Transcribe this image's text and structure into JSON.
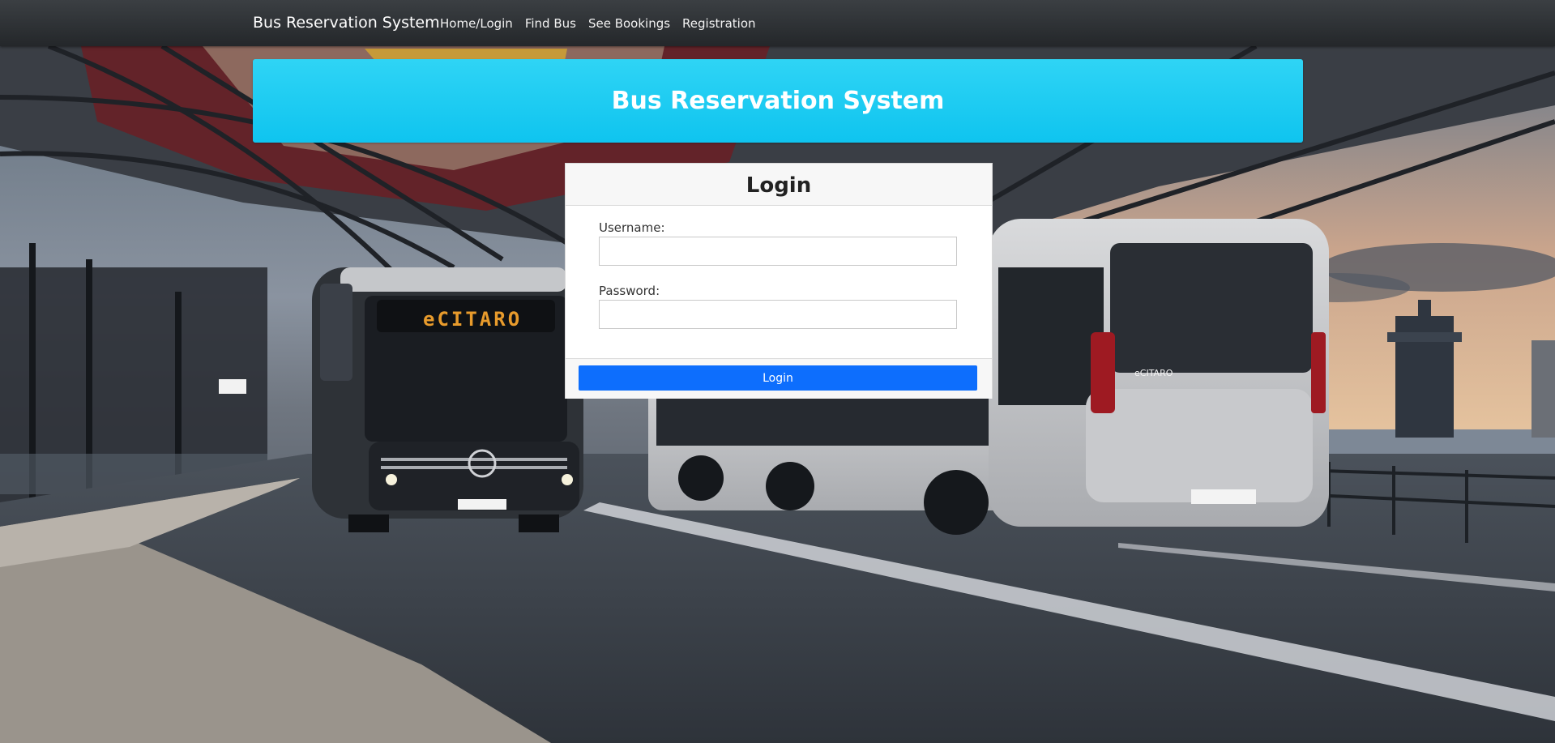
{
  "navbar": {
    "brand": "Bus Reservation System",
    "links": [
      "Home/Login",
      "Find Bus",
      "See Bookings",
      "Registration"
    ]
  },
  "jumbotron": {
    "title": "Bus Reservation System"
  },
  "login": {
    "title": "Login",
    "username_label": "Username:",
    "username_value": "",
    "password_label": "Password:",
    "password_value": "",
    "button_label": "Login"
  },
  "background": {
    "front_bus_destination": "eCITARO",
    "side_bus_model": "eCITARO"
  },
  "colors": {
    "navbar": "#2b2e32",
    "jumbotron": "#1ccaf2",
    "button": "#0d6efd"
  }
}
